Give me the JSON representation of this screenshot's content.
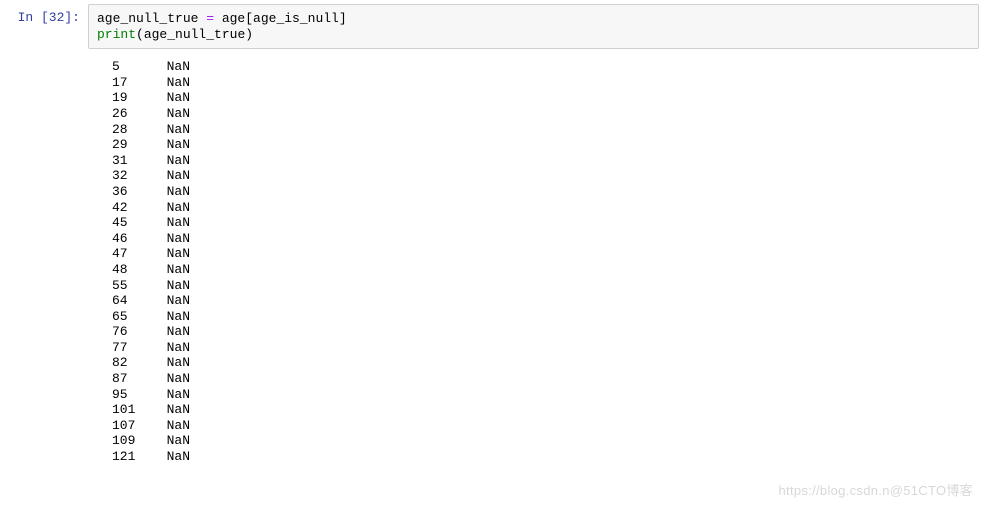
{
  "cell": {
    "prompt": "In [32]:",
    "code": {
      "line1_var": "age_null_true ",
      "line1_op": "=",
      "line1_rhs": " age[age_is_null]",
      "line2_fn": "print",
      "line2_open": "(",
      "line2_arg": "age_null_true",
      "line2_close": ")"
    }
  },
  "output_rows": [
    {
      "idx": "5",
      "val": "NaN"
    },
    {
      "idx": "17",
      "val": "NaN"
    },
    {
      "idx": "19",
      "val": "NaN"
    },
    {
      "idx": "26",
      "val": "NaN"
    },
    {
      "idx": "28",
      "val": "NaN"
    },
    {
      "idx": "29",
      "val": "NaN"
    },
    {
      "idx": "31",
      "val": "NaN"
    },
    {
      "idx": "32",
      "val": "NaN"
    },
    {
      "idx": "36",
      "val": "NaN"
    },
    {
      "idx": "42",
      "val": "NaN"
    },
    {
      "idx": "45",
      "val": "NaN"
    },
    {
      "idx": "46",
      "val": "NaN"
    },
    {
      "idx": "47",
      "val": "NaN"
    },
    {
      "idx": "48",
      "val": "NaN"
    },
    {
      "idx": "55",
      "val": "NaN"
    },
    {
      "idx": "64",
      "val": "NaN"
    },
    {
      "idx": "65",
      "val": "NaN"
    },
    {
      "idx": "76",
      "val": "NaN"
    },
    {
      "idx": "77",
      "val": "NaN"
    },
    {
      "idx": "82",
      "val": "NaN"
    },
    {
      "idx": "87",
      "val": "NaN"
    },
    {
      "idx": "95",
      "val": "NaN"
    },
    {
      "idx": "101",
      "val": "NaN"
    },
    {
      "idx": "107",
      "val": "NaN"
    },
    {
      "idx": "109",
      "val": "NaN"
    },
    {
      "idx": "121",
      "val": "NaN"
    }
  ],
  "watermark": "https://blog.csdn.n@51CTO博客"
}
